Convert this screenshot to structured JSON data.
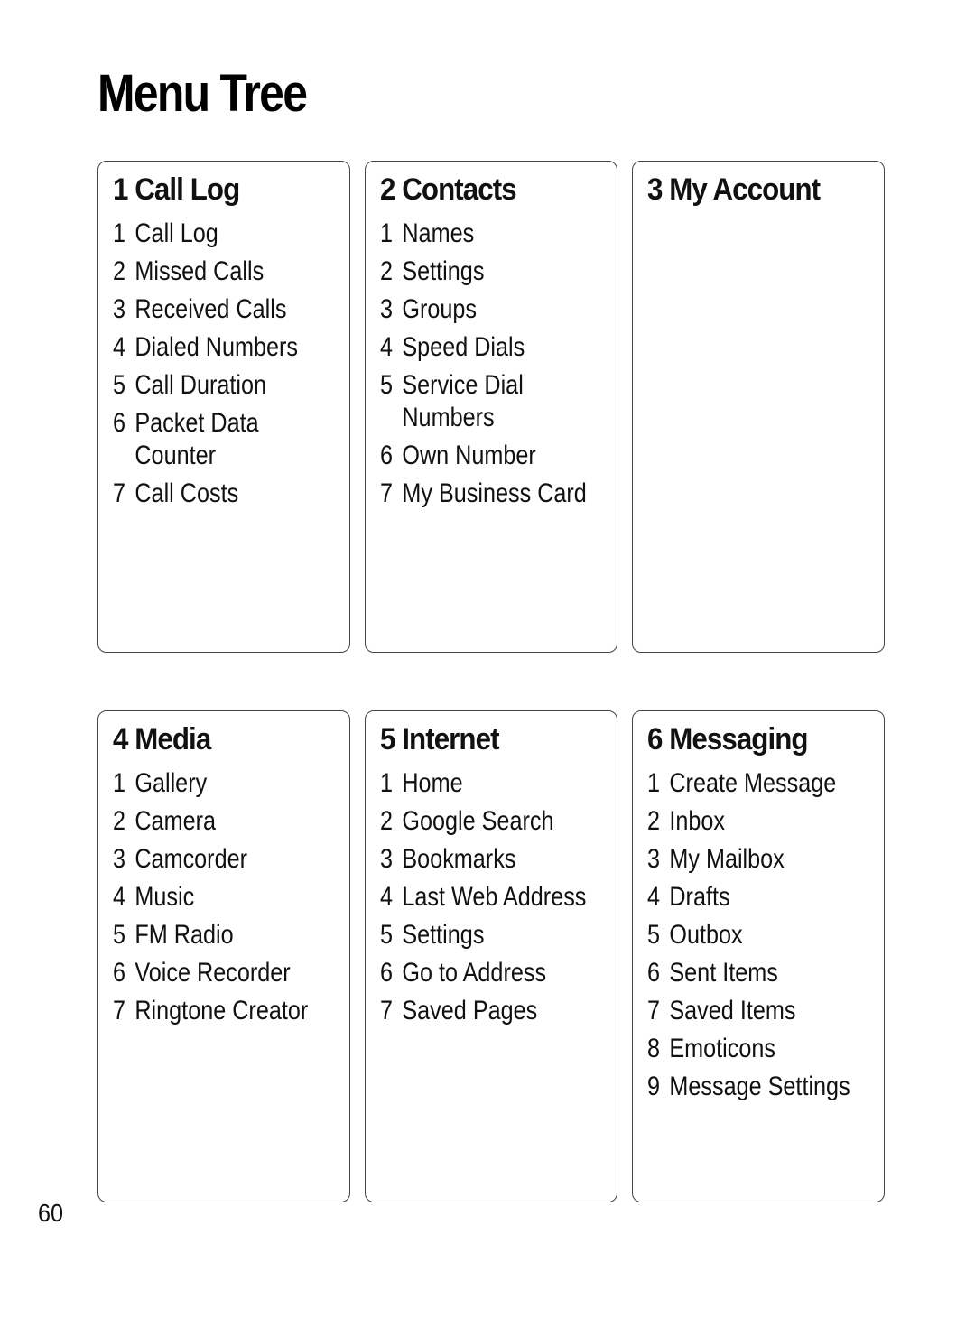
{
  "page": {
    "title": "Menu Tree",
    "page_number": "60"
  },
  "sections": [
    {
      "title": "1 Call Log",
      "items": [
        {
          "num": "1",
          "label": "Call Log"
        },
        {
          "num": "2",
          "label": "Missed Calls"
        },
        {
          "num": "3",
          "label": "Received Calls"
        },
        {
          "num": "4",
          "label": "Dialed Numbers"
        },
        {
          "num": "5",
          "label": "Call Duration"
        },
        {
          "num": "6",
          "label": "Packet Data\nCounter"
        },
        {
          "num": "7",
          "label": "Call Costs"
        }
      ]
    },
    {
      "title": "2 Contacts",
      "items": [
        {
          "num": "1",
          "label": "Names"
        },
        {
          "num": "2",
          "label": "Settings"
        },
        {
          "num": "3",
          "label": "Groups"
        },
        {
          "num": "4",
          "label": "Speed Dials"
        },
        {
          "num": "5",
          "label": "Service Dial\nNumbers"
        },
        {
          "num": "6",
          "label": "Own Number"
        },
        {
          "num": "7",
          "label": "My Business Card"
        }
      ]
    },
    {
      "title": "3 My Account",
      "items": []
    },
    {
      "title": "4 Media",
      "items": [
        {
          "num": "1",
          "label": "Gallery"
        },
        {
          "num": "2",
          "label": "Camera"
        },
        {
          "num": "3",
          "label": "Camcorder"
        },
        {
          "num": "4",
          "label": "Music"
        },
        {
          "num": "5",
          "label": "FM Radio"
        },
        {
          "num": "6",
          "label": "Voice Recorder"
        },
        {
          "num": "7",
          "label": "Ringtone Creator"
        }
      ]
    },
    {
      "title": "5 Internet",
      "items": [
        {
          "num": "1",
          "label": "Home"
        },
        {
          "num": "2",
          "label": "Google Search"
        },
        {
          "num": "3",
          "label": "Bookmarks"
        },
        {
          "num": "4",
          "label": "Last Web Address"
        },
        {
          "num": "5",
          "label": "Settings"
        },
        {
          "num": "6",
          "label": "Go to Address"
        },
        {
          "num": "7",
          "label": "Saved Pages"
        }
      ]
    },
    {
      "title": "6 Messaging",
      "items": [
        {
          "num": "1",
          "label": "Create Message"
        },
        {
          "num": "2",
          "label": "Inbox"
        },
        {
          "num": "3",
          "label": "My Mailbox"
        },
        {
          "num": "4",
          "label": "Drafts"
        },
        {
          "num": "5",
          "label": "Outbox"
        },
        {
          "num": "6",
          "label": "Sent Items"
        },
        {
          "num": "7",
          "label": "Saved Items"
        },
        {
          "num": "8",
          "label": "Emoticons"
        },
        {
          "num": "9",
          "label": "Message Settings"
        }
      ]
    }
  ]
}
